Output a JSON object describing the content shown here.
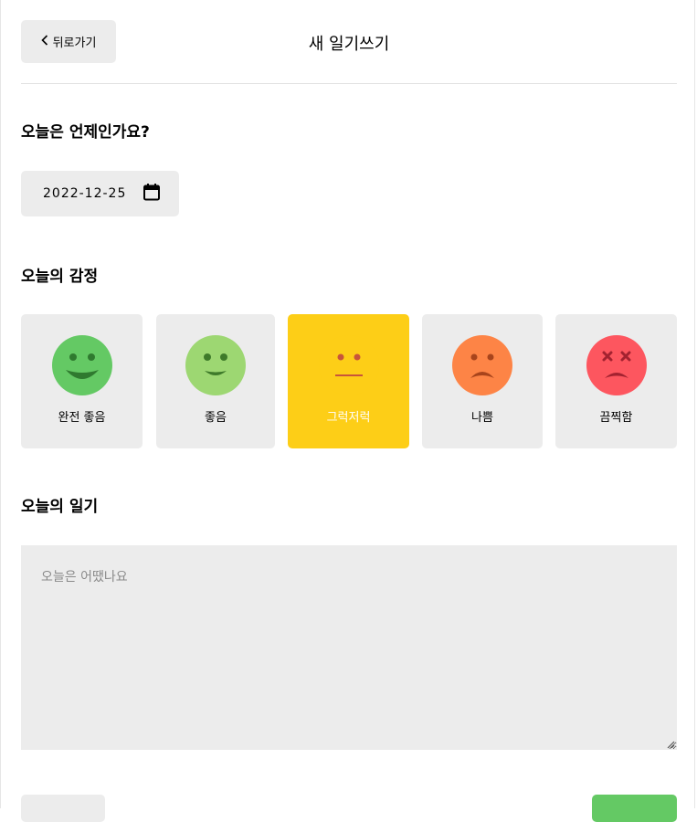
{
  "header": {
    "back_label": "뒤로가기",
    "title": "새 일기쓰기"
  },
  "date_section": {
    "title": "오늘은 언제인가요?",
    "date_value": "2022-12-25"
  },
  "emotion_section": {
    "title": "오늘의 감정",
    "selected_index": 2,
    "items": [
      {
        "label": "완전 좋음",
        "color": "#64c964",
        "icon": "very-happy-face-icon"
      },
      {
        "label": "좋음",
        "color": "#9dd772",
        "icon": "happy-face-icon"
      },
      {
        "label": "그럭저럭",
        "color": "#fdce17",
        "icon": "neutral-face-icon"
      },
      {
        "label": "나쁨",
        "color": "#fd8446",
        "icon": "sad-face-icon"
      },
      {
        "label": "끔찍함",
        "color": "#fd565f",
        "icon": "terrible-face-icon"
      }
    ]
  },
  "diary_section": {
    "title": "오늘의 일기",
    "placeholder": "오늘은 어땠나요",
    "value": ""
  },
  "colors": {
    "surface": "#ececec",
    "accent_green": "#64c964",
    "selected_yellow": "#fdce17"
  }
}
